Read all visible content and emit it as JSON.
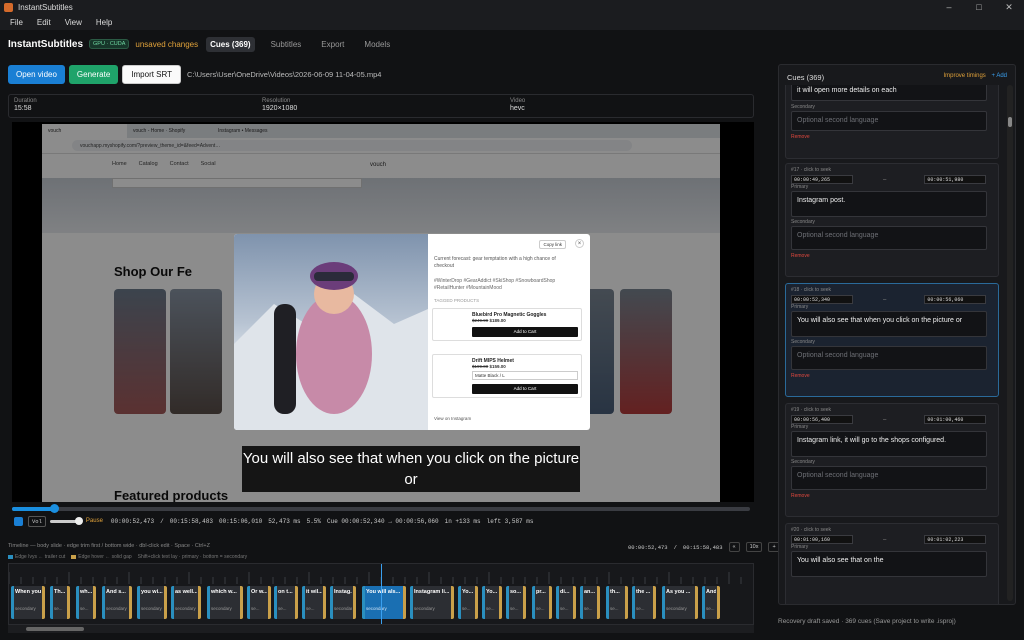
{
  "app": {
    "window_title": "InstantSubtitles",
    "menu": [
      "File",
      "Edit",
      "View",
      "Help"
    ],
    "window_controls": [
      "–",
      "□",
      "✕"
    ],
    "brand": "InstantSubtitles",
    "gpu_badge": "GPU · CUDA",
    "unsaved": "unsaved changes",
    "tabs": [
      "Cues (369)",
      "Subtitles",
      "Export",
      "Models"
    ],
    "active_tab": "Cues (369)"
  },
  "toolbar": {
    "open_video": "Open video",
    "generate": "Generate",
    "import_srt": "Import SRT",
    "path": "C:\\Users\\User\\OneDrive\\Videos\\2026-06-09 11-04-05.mp4"
  },
  "meta": [
    {
      "label": "Duration",
      "value": "15:58"
    },
    {
      "label": "Resolution",
      "value": "1920×1080"
    },
    {
      "label": "Video",
      "value": "hevc"
    }
  ],
  "video_frame": {
    "browser_tabs": [
      "vouch",
      "vouch - Home · Shopify",
      "Instagram • Messages"
    ],
    "url": "vouchapp.myshopify.com/?preview_theme_id=&feed=Advent…",
    "site_nav": [
      "Home",
      "Catalog",
      "Contact",
      "Social"
    ],
    "site_brand": "vouch",
    "shop_title": "Shop Our Fe",
    "featured_title": "Featured products",
    "modal": {
      "copy_link": "Copy link",
      "caption": "Current forecast: gear temptation with a high chance of checkout",
      "hashtags": "#WinterDrop #GearAddict #SkiShop #SnowboardShop #RetailHunter #MountainMood",
      "tagged": "TAGGED PRODUCTS",
      "products": [
        {
          "name": "Bluebird Pro Magnetic Goggles",
          "old_price": "$249.99",
          "price": "$189.00",
          "cta": "Add to Cart"
        },
        {
          "name": "Drift MIPS Helmet",
          "old_price": "$199.00",
          "price": "$159.00",
          "variant": "Matte Black / L",
          "cta": "Add to Cart"
        }
      ],
      "view_on": "View on Instagram"
    },
    "subtitle": "You will also see that when you click on the picture or"
  },
  "player": {
    "progress": 0.057,
    "volume_label": "Vol",
    "volume": 1.0,
    "state": "Pause",
    "position": "00:00:52,473",
    "duration": "00:15:58,483",
    "extra_time": "00:15:06,010",
    "ms": "52,473 ms",
    "rate": "5.5%",
    "cue_range": "Cue 00:00:52,340 → 00:00:56,060",
    "cue_in": "in +133 ms",
    "cue_left": "left 3,587 ms"
  },
  "timeline": {
    "hint": "Timeline — body slide · edge trim first / bottom wide · dbl-click edit · Space · Ctrl+Z",
    "legend": [
      "Edge Ivys ← trailer cut",
      "Edge hover ← solid gap",
      "Shift+click text lay · primary · bottom = secondary"
    ],
    "time_left": "00:00:52,473",
    "time_right": "00:15:58,483",
    "nav_prev": "«",
    "zoom": "10x",
    "nav_next": "+",
    "cues": [
      {
        "text": "When you s...",
        "sec": "secondary"
      },
      {
        "text": "Th...",
        "sec": "se..."
      },
      {
        "text": "wh...",
        "sec": "se..."
      },
      {
        "text": "And s...",
        "sec": "secondary"
      },
      {
        "text": "you wi...",
        "sec": "secondary"
      },
      {
        "text": "as well...",
        "sec": "secondary"
      },
      {
        "text": "which w...",
        "sec": "secondary"
      },
      {
        "text": "Or w...",
        "sec": "se..."
      },
      {
        "text": "on t...",
        "sec": "se..."
      },
      {
        "text": "it wil...",
        "sec": "se..."
      },
      {
        "text": "Instag...",
        "sec": "secondary"
      },
      {
        "text": "You will als...",
        "sec": "secondary"
      },
      {
        "text": "Instagram li...",
        "sec": "secondary"
      },
      {
        "text": "Yo...",
        "sec": "se..."
      },
      {
        "text": "Yo...",
        "sec": "se..."
      },
      {
        "text": "so...",
        "sec": "se..."
      },
      {
        "text": "pr...",
        "sec": "se..."
      },
      {
        "text": "di...",
        "sec": "se..."
      },
      {
        "text": "an...",
        "sec": "se..."
      },
      {
        "text": "th...",
        "sec": "se..."
      },
      {
        "text": "the ...",
        "sec": "se..."
      },
      {
        "text": "As you ...",
        "sec": "secondary"
      },
      {
        "text": "And",
        "sec": "se..."
      }
    ]
  },
  "sidebar": {
    "title": "Cues (369)",
    "improve": "Improve timings",
    "add": "+ Add",
    "secondary_label": "Secondary",
    "primary_label": "Primary",
    "secondary_placeholder": "Optional second language",
    "remove": "Remove",
    "partial_primary": "it will open more details on each",
    "cues": [
      {
        "head": "#17 · click to seek",
        "start": "00:00:49,265",
        "end": "00:00:51,980",
        "primary": "Instagram post."
      },
      {
        "head": "#18 · click to seek",
        "start": "00:00:52,340",
        "end": "00:00:56,060",
        "primary": "You will also see that when you click on the picture or"
      },
      {
        "head": "#19 · click to seek",
        "start": "00:00:56,400",
        "end": "00:01:00,460",
        "primary": "Instagram link, it will go to the shops configured."
      },
      {
        "head": "#20 · click to seek",
        "start": "00:01:00,160",
        "end": "00:01:02,223",
        "primary": "You will also see that on the"
      }
    ]
  },
  "footer": "Recovery draft saved · 369 cues (Save project to write .isproj)",
  "colors": {
    "accent": "#1a7fd4",
    "generate": "#1fa36a",
    "warning": "#e1a23a",
    "remove": "#e0483e",
    "background": "#111214"
  }
}
